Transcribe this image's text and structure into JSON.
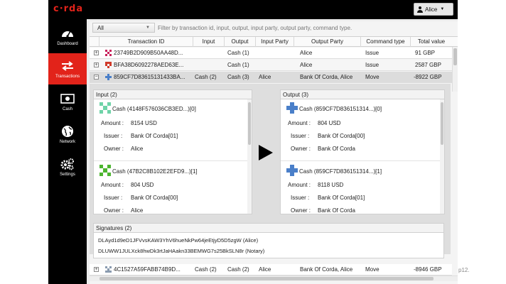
{
  "app": {
    "logo_text": "c·rda",
    "user_label": "Alice",
    "accent": "#e2231a"
  },
  "sidebar": {
    "items": [
      {
        "label": "Dashboard",
        "icon": "gauge-icon"
      },
      {
        "label": "Transactions",
        "icon": "swap-arrows-icon",
        "active": true
      },
      {
        "label": "Cash",
        "icon": "banknote-icon"
      },
      {
        "label": "Network",
        "icon": "globe-icon"
      },
      {
        "label": "Settings",
        "icon": "gears-icon"
      }
    ]
  },
  "filter": {
    "selected": "All",
    "placeholder": "Filter by transaction id, input, output, input party, output party, command type."
  },
  "table": {
    "columns": [
      "Transaction ID",
      "Input",
      "Output",
      "Input Party",
      "Output Party",
      "Command type",
      "Total value"
    ],
    "rows": [
      {
        "id": "23749B2D909B50AA48D...",
        "input": "",
        "output": "Cash (1)",
        "input_party": "",
        "output_party": "Alice",
        "command": "Issue",
        "total": "91 GBP"
      },
      {
        "id": "BFA38D6092278AED63E...",
        "input": "",
        "output": "Cash (1)",
        "input_party": "",
        "output_party": "Alice",
        "command": "Issue",
        "total": "2587 GBP"
      },
      {
        "id": "859CF7D83615131433BA...",
        "input": "Cash (2)",
        "output": "Cash (3)",
        "input_party": "Alice",
        "output_party": "Bank Of Corda, Alice",
        "command": "Move",
        "total": "-8922 GBP"
      }
    ],
    "last_row": {
      "id": "4C1527A59FABB74B9D...",
      "input": "Cash (2)",
      "output": "Cash (2)",
      "input_party": "Alice",
      "output_party": "Bank Of Corda, Alice",
      "command": "Move",
      "total": "-8946 GBP"
    }
  },
  "detail": {
    "input_title": "Input (2)",
    "output_title": "Output (3)",
    "field_labels": {
      "amount": "Amount :",
      "issuer": "Issuer :",
      "owner": "Owner :"
    },
    "inputs": [
      {
        "title": "Cash (4148F576036CB3ED...)[0]",
        "amount": "8154 USD",
        "issuer": "Bank Of Corda[01]",
        "owner": "Alice"
      },
      {
        "title": "Cash (47B2C8B102E2EFD9...)[1]",
        "amount": "804 USD",
        "issuer": "Bank Of Corda[00]",
        "owner": "Alice"
      }
    ],
    "outputs": [
      {
        "title": "Cash (859CF7D836151314...)[0]",
        "amount": "804 USD",
        "issuer": "Bank Of Corda[00]",
        "owner": "Bank Of Corda"
      },
      {
        "title": "Cash (859CF7D836151314...)[1]",
        "amount": "8118 USD",
        "issuer": "Bank Of Corda[01]",
        "owner": "Bank Of Corda"
      }
    ],
    "signatures_title": "Signatures (2)",
    "signatures": [
      "DLAyd1d9eD1JFVvsKAW3YhV6hueNkPw64jeEtjyD5D5zgW (Alice)",
      "DLUWW1JULXck8hwDk3rtJaHAakn33BEMWG7s25BkSLN8r (Notary)"
    ]
  },
  "footer": {
    "page_indicator": "p12."
  }
}
